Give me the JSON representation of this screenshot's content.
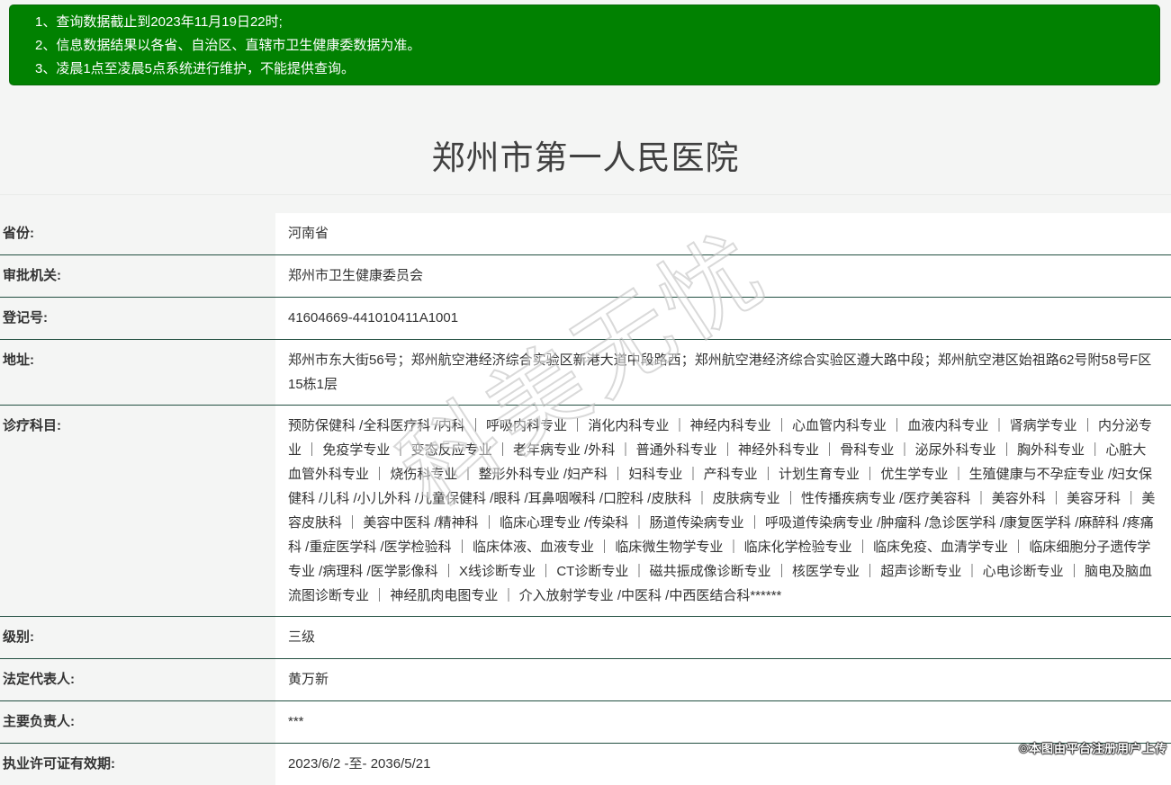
{
  "notice": {
    "lines": [
      "1、查询数据截止到2023年11月19日22时;",
      "2、信息数据结果以各省、自治区、直辖市卫生健康委数据为准。",
      "3、凌晨1点至凌晨5点系统进行维护，不能提供查询。"
    ]
  },
  "header": {
    "title": "郑州市第一人民医院"
  },
  "info_table": {
    "rows": [
      {
        "label": "省份:",
        "value": "河南省"
      },
      {
        "label": "审批机关:",
        "value": "郑州市卫生健康委员会"
      },
      {
        "label": "登记号:",
        "value": "41604669-441010411A1001"
      },
      {
        "label": "地址:",
        "value": "郑州市东大街56号；郑州航空港经济综合实验区新港大道中段路西；郑州航空港经济综合实验区遵大路中段；郑州航空港区始祖路62号附58号F区15栋1层"
      },
      {
        "label": "诊疗科目:",
        "value": "预防保健科 /全科医疗科 /内科 ｜ 呼吸内科专业 ｜ 消化内科专业 ｜ 神经内科专业 ｜ 心血管内科专业 ｜ 血液内科专业 ｜ 肾病学专业 ｜ 内分泌专业 ｜ 免疫学专业 ｜ 变态反应专业 ｜ 老年病专业 /外科 ｜ 普通外科专业 ｜ 神经外科专业 ｜ 骨科专业 ｜ 泌尿外科专业 ｜ 胸外科专业 ｜ 心脏大血管外科专业 ｜ 烧伤科专业 ｜ 整形外科专业 /妇产科 ｜ 妇科专业 ｜ 产科专业 ｜ 计划生育专业 ｜ 优生学专业 ｜ 生殖健康与不孕症专业 /妇女保健科 /儿科 /小儿外科 /儿童保健科 /眼科 /耳鼻咽喉科 /口腔科 /皮肤科 ｜ 皮肤病专业 ｜ 性传播疾病专业 /医疗美容科 ｜ 美容外科 ｜ 美容牙科 ｜ 美容皮肤科 ｜ 美容中医科 /精神科 ｜ 临床心理专业 /传染科 ｜ 肠道传染病专业 ｜ 呼吸道传染病专业 /肿瘤科 /急诊医学科 /康复医学科 /麻醉科 /疼痛科 /重症医学科 /医学检验科 ｜ 临床体液、血液专业 ｜ 临床微生物学专业 ｜ 临床化学检验专业 ｜ 临床免疫、血清学专业 ｜ 临床细胞分子遗传学专业 /病理科 /医学影像科 ｜ X线诊断专业 ｜ CT诊断专业 ｜ 磁共振成像诊断专业 ｜ 核医学专业 ｜ 超声诊断专业 ｜ 心电诊断专业 ｜ 脑电及脑血流图诊断专业 ｜ 神经肌肉电图专业 ｜ 介入放射学专业 /中医科 /中西医结合科******"
      },
      {
        "label": "级别:",
        "value": "三级"
      },
      {
        "label": "法定代表人:",
        "value": "黄万新"
      },
      {
        "label": "主要负责人:",
        "value": "***"
      },
      {
        "label": "执业许可证有效期:",
        "value": "2023/6/2 -至- 2036/5/21"
      }
    ]
  },
  "watermarks": {
    "center": "科美无忧",
    "bottom_right": "©本图由平台注册用户上传"
  },
  "colors": {
    "notice_background": "#018101",
    "notice_border": "#0a6b0a",
    "notice_text": "#ffffff",
    "page_background": "#f4f5f4",
    "row_divider": "#224f41",
    "value_cell_background": "#ffffff",
    "body_text": "#333333",
    "title_text": "#404040"
  }
}
